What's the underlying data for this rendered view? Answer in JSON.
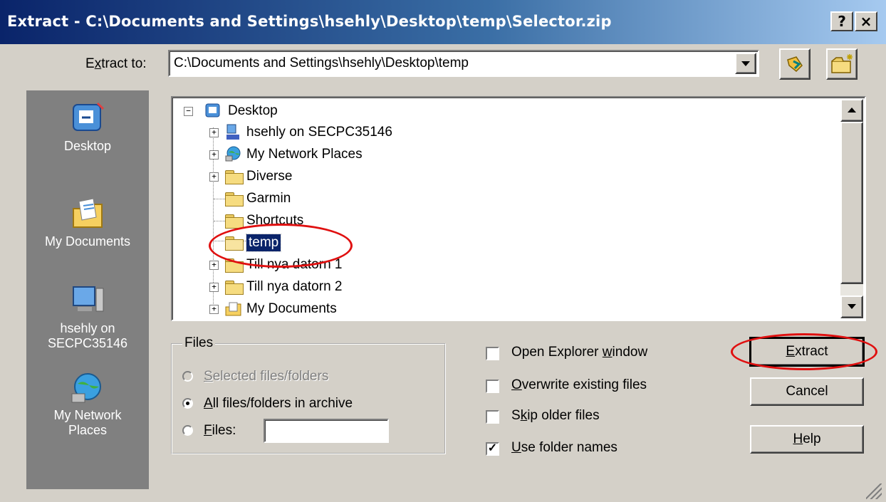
{
  "window": {
    "title": "Extract - C:\\Documents and Settings\\hsehly\\Desktop\\temp\\Selector.zip",
    "help_button": "?",
    "close_button": "×"
  },
  "extract_to": {
    "label_pre": "E",
    "label_accel": "x",
    "label_post": "tract to:",
    "path": "C:\\Documents and Settings\\hsehly\\Desktop\\temp"
  },
  "places": [
    {
      "label": "Desktop",
      "icon": "desktop-icon"
    },
    {
      "label": "My Documents",
      "icon": "my-documents-icon"
    },
    {
      "label_line1": "hsehly on",
      "label_line2": "SECPC35146",
      "icon": "computer-icon"
    },
    {
      "label_line1": "My Network",
      "label_line2": "Places",
      "icon": "network-icon"
    }
  ],
  "tree": {
    "root": "Desktop",
    "items": [
      {
        "label": "hsehly on SECPC35146",
        "icon": "computer-icon",
        "expander": "+"
      },
      {
        "label": "My Network Places",
        "icon": "network-icon",
        "expander": "+"
      },
      {
        "label": "Diverse",
        "icon": "folder-icon",
        "expander": "+"
      },
      {
        "label": "Garmin",
        "icon": "folder-icon",
        "expander": ""
      },
      {
        "label": "Shortcuts",
        "icon": "folder-icon",
        "expander": ""
      },
      {
        "label": "temp",
        "icon": "folder-open-icon",
        "expander": "",
        "selected": true
      },
      {
        "label": "Till nya datorn 1",
        "icon": "folder-icon",
        "expander": "+"
      },
      {
        "label": "Till nya datorn 2",
        "icon": "folder-icon",
        "expander": "+"
      },
      {
        "label": "My Documents",
        "icon": "my-documents-icon",
        "expander": "+"
      }
    ]
  },
  "files_group": {
    "legend": "Files",
    "options": [
      {
        "pre": "",
        "accel": "S",
        "post": "elected files/folders",
        "checked": false,
        "disabled": true
      },
      {
        "pre": "",
        "accel": "A",
        "post": "ll files/folders in archive",
        "checked": true,
        "disabled": false
      },
      {
        "pre": "",
        "accel": "F",
        "post": "iles:",
        "checked": false,
        "disabled": false
      }
    ],
    "files_value": ""
  },
  "options": [
    {
      "pre": "Open Explorer ",
      "accel": "w",
      "post": "indow",
      "checked": false
    },
    {
      "pre": "",
      "accel": "O",
      "post": "verwrite existing files",
      "checked": false
    },
    {
      "pre": "S",
      "accel": "k",
      "post": "ip older files",
      "checked": false
    },
    {
      "pre": "",
      "accel": "U",
      "post": "se folder names",
      "checked": true
    }
  ],
  "buttons": {
    "extract": {
      "pre": "",
      "accel": "E",
      "post": "xtract"
    },
    "cancel": {
      "pre": "Cancel",
      "accel": "",
      "post": ""
    },
    "help": {
      "pre": "",
      "accel": "H",
      "post": "elp"
    }
  },
  "colors": {
    "title_start": "#0a246a",
    "title_end": "#a6caf0",
    "face": "#d4d0c8",
    "selection": "#0a246a",
    "annotation": "#e01010"
  }
}
